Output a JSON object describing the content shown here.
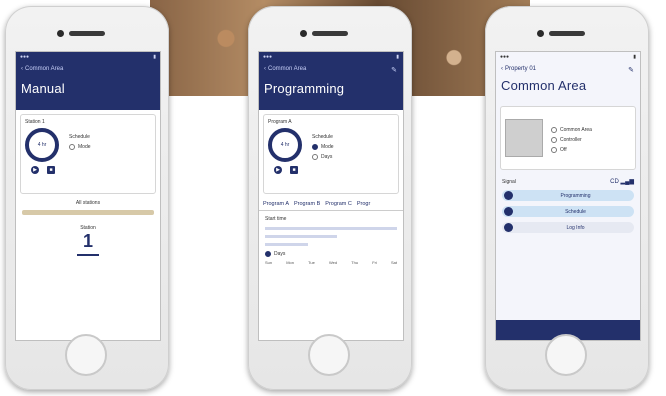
{
  "phones": [
    {
      "screen": {
        "back_label": "Common Area",
        "title": "Manual",
        "zone_label": "Station 1",
        "dial_label": "4 hr",
        "schedule_label": "Schedule",
        "mode_label": "Mode",
        "play_icon": "play-icon",
        "stop_icon": "stop-icon",
        "section_label": "All stations",
        "counter_label": "Station",
        "counter_value": "1"
      }
    },
    {
      "screen": {
        "back_label": "Common Area",
        "title": "Programming",
        "zone_label": "Program A",
        "dial_label": "4 hr",
        "schedule_label": "Schedule",
        "option_a": "Mode",
        "option_b": "Days",
        "tabs": [
          "Program A",
          "Program B",
          "Program C",
          "Progr"
        ],
        "list_label_1": "Start time",
        "list_label_2": "Days",
        "weekdays": [
          "Sun",
          "Mon",
          "Tue",
          "Wed",
          "Thu",
          "Fri",
          "Sat"
        ]
      }
    },
    {
      "screen": {
        "back_label": "Property 01",
        "title": "Common Area",
        "options": [
          "Common Area",
          "Controller",
          "Off"
        ],
        "signal_label": "Signal",
        "signal_value": "CD",
        "buttons": [
          "Programming",
          "Schedule",
          "Log Info"
        ]
      }
    }
  ],
  "colors": {
    "navy": "#23306b",
    "pill": "#cde2f4"
  }
}
